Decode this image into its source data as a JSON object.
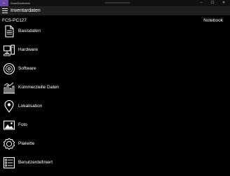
{
  "window": {
    "app_title": "Scan2InvAdmin"
  },
  "appbar": {
    "title": "Inventardaten"
  },
  "device": {
    "name": "FCS-PC127",
    "type": "Notebook"
  },
  "menu": {
    "items": [
      {
        "label": "Basisdaten",
        "icon": "document-icon"
      },
      {
        "label": "Hardware",
        "icon": "computer-icon"
      },
      {
        "label": "Software",
        "icon": "disc-icon"
      },
      {
        "label": "Kommerzielle Daten",
        "icon": "commercial-chart-icon"
      },
      {
        "label": "Lokalisation",
        "icon": "location-pin-icon"
      },
      {
        "label": "Foto",
        "icon": "photo-icon"
      },
      {
        "label": "Plakette",
        "icon": "badge-icon"
      },
      {
        "label": "Benutzerdefiniert",
        "icon": "custom-list-icon"
      }
    ]
  },
  "colors": {
    "accent": "#6b45a8",
    "background": "#000000",
    "appbar": "#1f1f1f"
  }
}
